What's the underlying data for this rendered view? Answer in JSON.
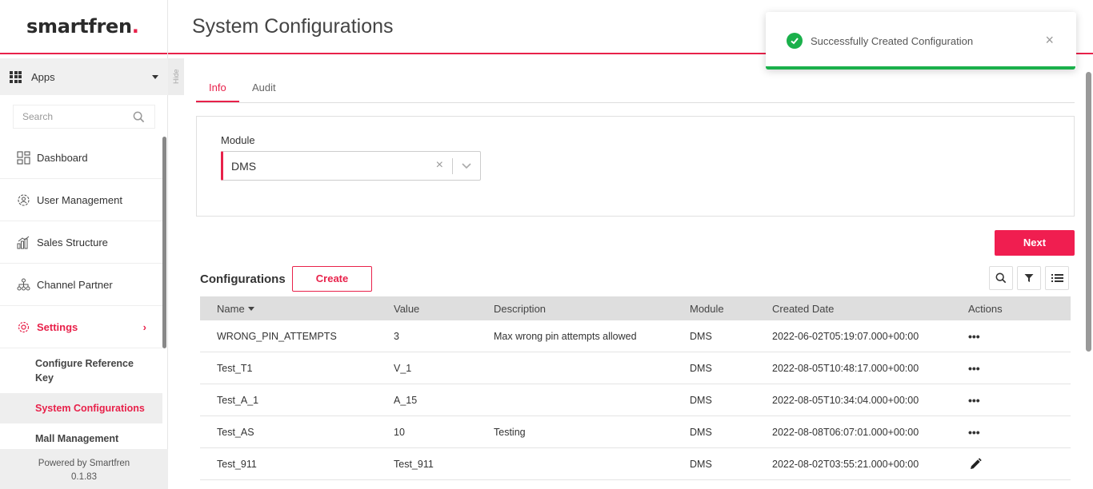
{
  "brand": {
    "logo_text": "smartfren",
    "logo_dot": ".",
    "accent_color": "#e8214a"
  },
  "sidebar": {
    "apps_label": "Apps",
    "hide_label": "Hide",
    "search_placeholder": "Search",
    "items": [
      {
        "label": "Dashboard",
        "icon": "dashboard-icon"
      },
      {
        "label": "User Management",
        "icon": "user-gear-icon"
      },
      {
        "label": "Sales Structure",
        "icon": "bar-chart-icon"
      },
      {
        "label": "Channel Partner",
        "icon": "network-icon"
      },
      {
        "label": "Settings",
        "icon": "gear-icon",
        "active": true,
        "chevron": "›"
      }
    ],
    "sub_items": [
      {
        "label": "Configure Reference Key"
      },
      {
        "label": "System Configurations",
        "selected": true
      },
      {
        "label": "Mall Management"
      }
    ],
    "footer": {
      "powered_by": "Powered by Smartfren",
      "version": "0.1.83"
    }
  },
  "header": {
    "title": "System Configurations"
  },
  "toast": {
    "message": "Successfully Created Configuration",
    "close": "×",
    "status_color": "#1ab04b"
  },
  "tabs": [
    {
      "label": "Info",
      "active": true
    },
    {
      "label": "Audit"
    }
  ],
  "module_filter": {
    "label": "Module",
    "value": "DMS",
    "clear": "×"
  },
  "actions": {
    "next_label": "Next",
    "create_label": "Create"
  },
  "configurations": {
    "title": "Configurations",
    "columns": [
      "Name",
      "Value",
      "Description",
      "Module",
      "Created Date",
      "Actions"
    ],
    "sort_column": "Name",
    "rows": [
      {
        "name": "WRONG_PIN_ATTEMPTS",
        "value": "3",
        "description": "Max wrong pin attempts allowed",
        "module": "DMS",
        "created": "2022-06-02T05:19:07.000+00:00",
        "action": "•••"
      },
      {
        "name": "Test_T1",
        "value": "V_1",
        "description": "",
        "module": "DMS",
        "created": "2022-08-05T10:48:17.000+00:00",
        "action": "•••"
      },
      {
        "name": "Test_A_1",
        "value": "A_15",
        "description": "",
        "module": "DMS",
        "created": "2022-08-05T10:34:04.000+00:00",
        "action": "•••"
      },
      {
        "name": "Test_AS",
        "value": "10",
        "description": "Testing",
        "module": "DMS",
        "created": "2022-08-08T06:07:01.000+00:00",
        "action": "•••"
      },
      {
        "name": "Test_911",
        "value": "Test_911",
        "description": "",
        "module": "DMS",
        "created": "2022-08-02T03:55:21.000+00:00",
        "action": "edit"
      }
    ]
  }
}
